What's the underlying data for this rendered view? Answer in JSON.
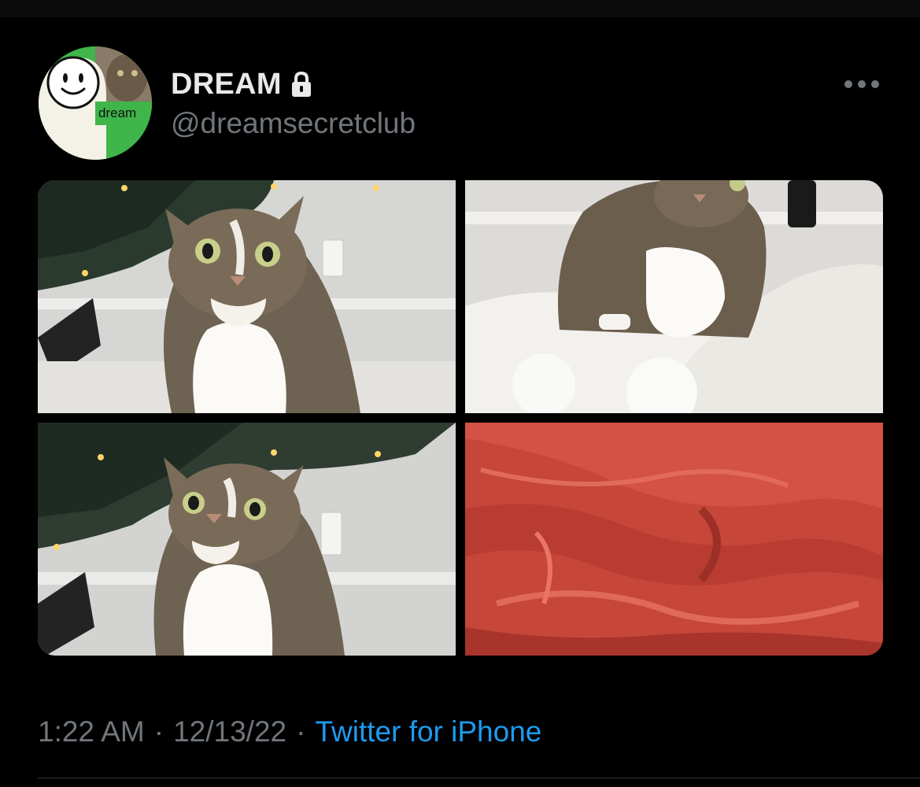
{
  "author": {
    "display_name": "DREAM",
    "handle": "@dreamsecretclub",
    "avatar_text": "dream",
    "protected_icon": "lock-icon"
  },
  "media": {
    "count": 4,
    "items": [
      {
        "subject": "tabby-cat-under-christmas-tree",
        "icon": "photo"
      },
      {
        "subject": "tabby-cat-on-white-blanket",
        "icon": "photo"
      },
      {
        "subject": "tabby-cat-looking-up",
        "icon": "photo"
      },
      {
        "subject": "red-tissue-paper",
        "icon": "photo"
      }
    ]
  },
  "meta": {
    "time": "1:22 AM",
    "separator": "·",
    "date": "12/13/22",
    "source": "Twitter for iPhone"
  },
  "menu": {
    "icon": "more-horizontal-icon"
  },
  "colors": {
    "background": "#000000",
    "primary_text": "#e7e9ea",
    "secondary_text": "#71767b",
    "link": "#1d9bf0",
    "divider": "#2f3336",
    "avatar_green": "#3fb54a"
  }
}
